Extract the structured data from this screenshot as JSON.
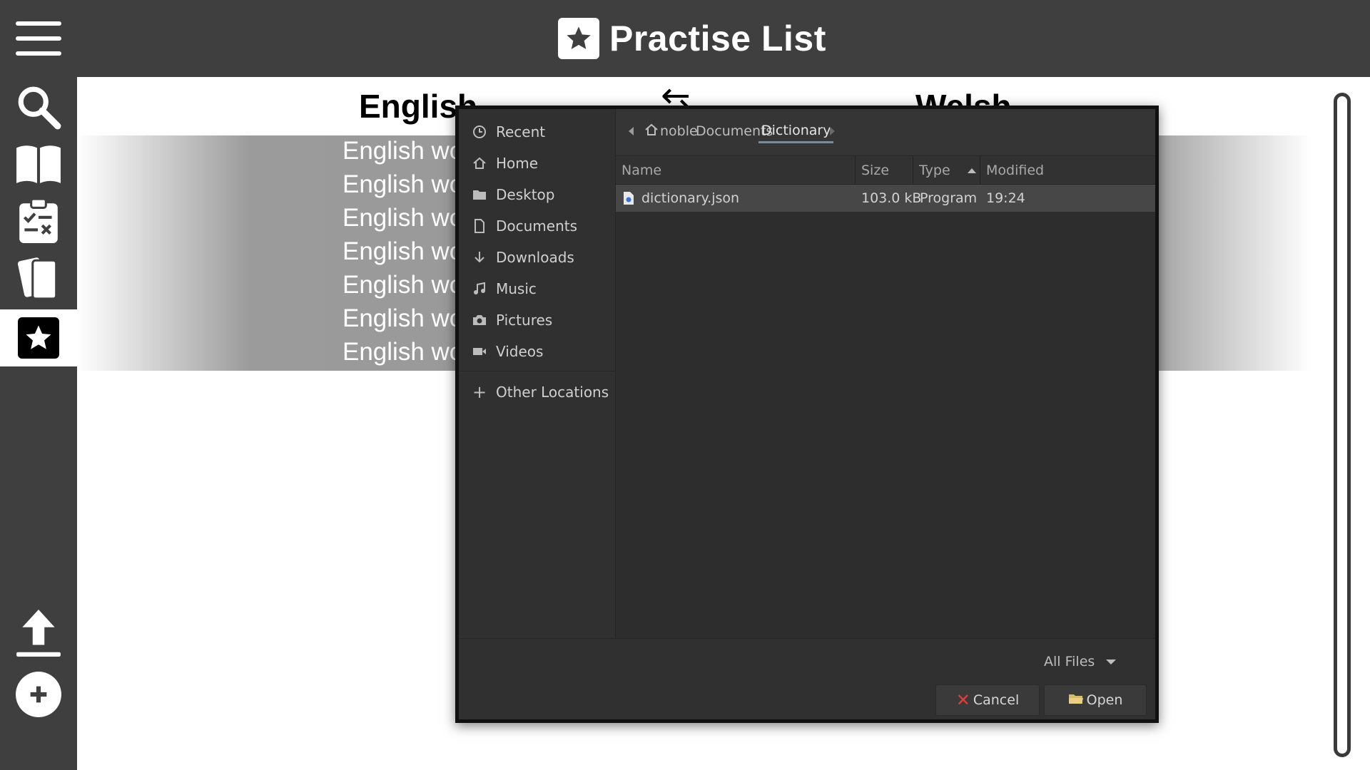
{
  "app": {
    "title": "Practise List"
  },
  "sidebar": {
    "items": [
      {
        "name": "search"
      },
      {
        "name": "dictionary"
      },
      {
        "name": "quiz"
      },
      {
        "name": "flashcards"
      },
      {
        "name": "practise-list",
        "active": true
      },
      {
        "name": "upload"
      },
      {
        "name": "add"
      }
    ]
  },
  "main": {
    "english_header": "English",
    "swap_arrow": "⇆",
    "welsh_header": "Welsh",
    "words": [
      "English word",
      "English word",
      "English word",
      "English word",
      "English word",
      "English word",
      "English word"
    ]
  },
  "dialog": {
    "places": [
      {
        "label": "Recent",
        "icon": "clock-icon"
      },
      {
        "label": "Home",
        "icon": "home-icon"
      },
      {
        "label": "Desktop",
        "icon": "folder-icon"
      },
      {
        "label": "Documents",
        "icon": "document-icon"
      },
      {
        "label": "Downloads",
        "icon": "download-icon"
      },
      {
        "label": "Music",
        "icon": "music-icon"
      },
      {
        "label": "Pictures",
        "icon": "camera-icon"
      },
      {
        "label": "Videos",
        "icon": "video-icon"
      }
    ],
    "other_locations": "Other Locations",
    "path": [
      "noble",
      "Documents",
      "Dictionary"
    ],
    "columns": {
      "name": "Name",
      "size": "Size",
      "type": "Type",
      "modified": "Modified"
    },
    "files": [
      {
        "name": "dictionary.json",
        "size": "103.0 kB",
        "type": "Program",
        "modified": "19:24"
      }
    ],
    "filter": "All Files",
    "cancel_label": "Cancel",
    "open_label": "Open"
  },
  "colors": {
    "chrome": "#3f3f3f",
    "dialog_bg": "#353535",
    "selected_row": "#474747",
    "cancel_x": "#e53b3b"
  }
}
